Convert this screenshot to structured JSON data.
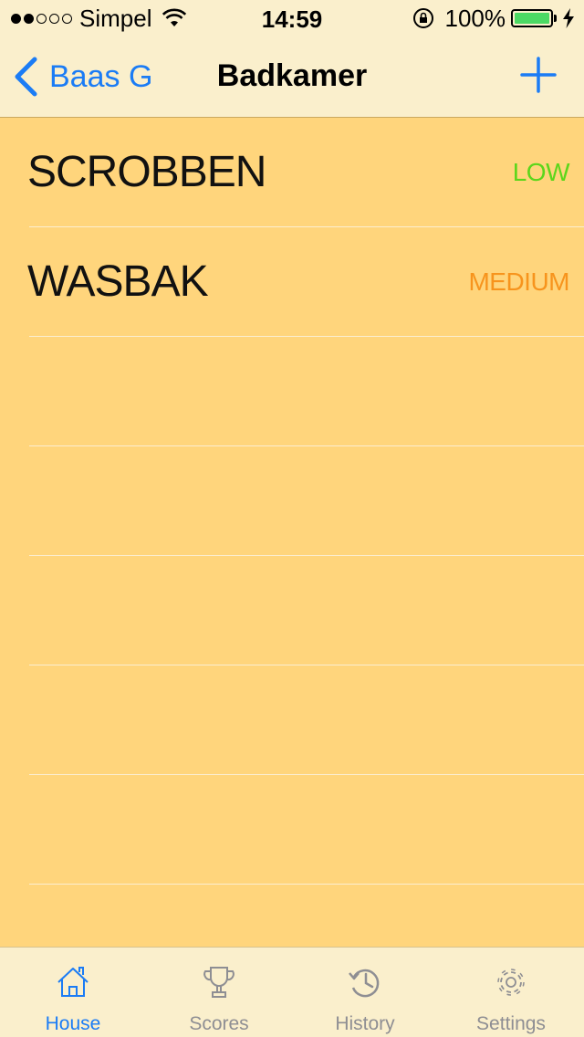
{
  "status_bar": {
    "carrier": "Simpel",
    "time": "14:59",
    "battery_percent": "100%",
    "signal_bars_filled": 2,
    "signal_bars_total": 5
  },
  "nav_bar": {
    "back_label": "Baas G",
    "title": "Badkamer",
    "add_icon": "plus-icon"
  },
  "colors": {
    "background": "#ffd57c",
    "bar_background": "#faefcc",
    "accent": "#1b7cf5",
    "priority_low": "#5cd61b",
    "priority_medium": "#f7941d",
    "tab_inactive": "#8e8e93"
  },
  "tasks": [
    {
      "title": "SCROBBEN",
      "priority": "LOW",
      "priority_color": "#5cd61b"
    },
    {
      "title": "WASBAK",
      "priority": "MEDIUM",
      "priority_color": "#f7941d"
    },
    {
      "title": "",
      "priority": "",
      "priority_color": ""
    },
    {
      "title": "",
      "priority": "",
      "priority_color": ""
    },
    {
      "title": "",
      "priority": "",
      "priority_color": ""
    },
    {
      "title": "",
      "priority": "",
      "priority_color": ""
    },
    {
      "title": "",
      "priority": "",
      "priority_color": ""
    }
  ],
  "tab_bar": {
    "tabs": [
      {
        "label": "House",
        "icon": "house-icon",
        "active": true
      },
      {
        "label": "Scores",
        "icon": "trophy-icon",
        "active": false
      },
      {
        "label": "History",
        "icon": "history-icon",
        "active": false
      },
      {
        "label": "Settings",
        "icon": "gear-icon",
        "active": false
      }
    ]
  }
}
